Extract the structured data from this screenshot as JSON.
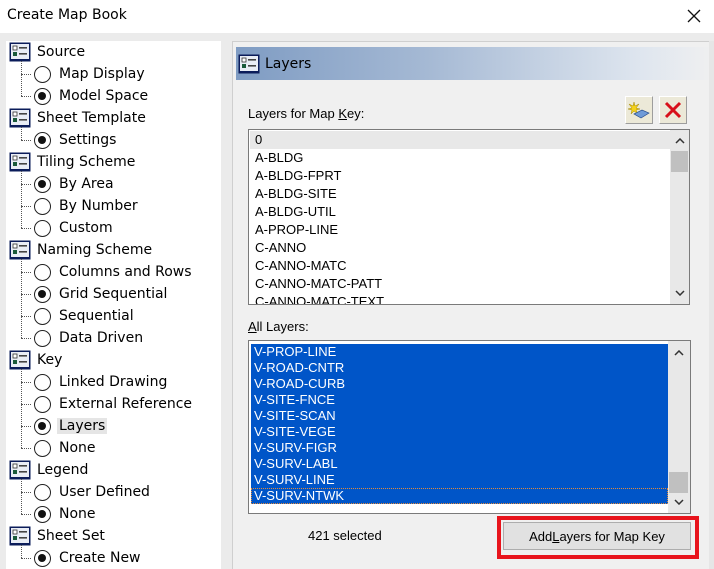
{
  "window": {
    "title": "Create Map Book",
    "close_icon": "close-icon"
  },
  "tree": {
    "groups": [
      {
        "label": "Source",
        "options": [
          {
            "label": "Map Display",
            "selected": false
          },
          {
            "label": "Model Space",
            "selected": true
          }
        ]
      },
      {
        "label": "Sheet Template",
        "options": [
          {
            "label": "Settings",
            "selected": true
          }
        ]
      },
      {
        "label": "Tiling Scheme",
        "options": [
          {
            "label": "By Area",
            "selected": true
          },
          {
            "label": "By Number",
            "selected": false
          },
          {
            "label": "Custom",
            "selected": false
          }
        ]
      },
      {
        "label": "Naming Scheme",
        "options": [
          {
            "label": "Columns and Rows",
            "selected": false
          },
          {
            "label": "Grid Sequential",
            "selected": true
          },
          {
            "label": "Sequential",
            "selected": false
          },
          {
            "label": "Data Driven",
            "selected": false
          }
        ]
      },
      {
        "label": "Key",
        "options": [
          {
            "label": "Linked Drawing",
            "selected": false
          },
          {
            "label": "External Reference",
            "selected": false
          },
          {
            "label": "Layers",
            "selected": true,
            "highlighted": true
          },
          {
            "label": "None",
            "selected": false
          }
        ]
      },
      {
        "label": "Legend",
        "options": [
          {
            "label": "User Defined",
            "selected": false
          },
          {
            "label": "None",
            "selected": true
          }
        ]
      },
      {
        "label": "Sheet Set",
        "options": [
          {
            "label": "Create New",
            "selected": true
          }
        ]
      }
    ]
  },
  "panel": {
    "title": "Layers",
    "map_key_label": "Layers for Map Key:",
    "map_key_label_parts": {
      "before": "Layers for Map ",
      "mnemonic": "K",
      "after": "ey:"
    },
    "add_layer_tooltip_icon": "add-layer-icon",
    "delete_icon": "delete-icon",
    "map_key_layers": [
      "0",
      "A-BLDG",
      "A-BLDG-FPRT",
      "A-BLDG-SITE",
      "A-BLDG-UTIL",
      "A-PROP-LINE",
      "C-ANNO",
      "C-ANNO-MATC",
      "C-ANNO-MATC-PATT",
      "C-ANNO-MATC-TEXT"
    ],
    "all_layers_label_parts": {
      "mnemonic": "A",
      "after": "ll Layers:"
    },
    "all_layers": [
      "V-PROP-LINE",
      "V-ROAD-CNTR",
      "V-ROAD-CURB",
      "V-SITE-FNCE",
      "V-SITE-SCAN",
      "V-SITE-VEGE",
      "V-SURV-FIGR",
      "V-SURV-LABL",
      "V-SURV-LINE",
      "V-SURV-NTWK"
    ],
    "selected_count_text": "421 selected",
    "add_button": {
      "before": "Add ",
      "mnemonic": "L",
      "after": "ayers for Map Key"
    }
  },
  "colors": {
    "selection": "#0055c8",
    "highlight_box": "#e8141c",
    "header_gradient_start": "#7f9cc3"
  }
}
